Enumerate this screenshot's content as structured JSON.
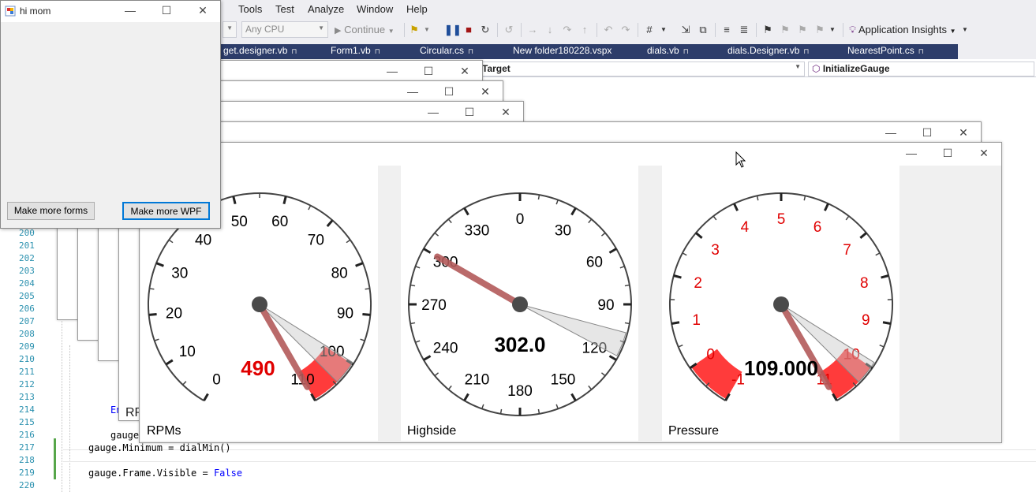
{
  "vs": {
    "menu": [
      "Tools",
      "Test",
      "Analyze",
      "Window",
      "Help"
    ],
    "toolbar": {
      "platform": "Any CPU",
      "continue_label": "Continue",
      "app_insights": "Application Insights"
    },
    "tabs": [
      {
        "label": "get.designer.vb"
      },
      {
        "label": "Form1.vb"
      },
      {
        "label": "Circular.cs"
      },
      {
        "label": "New folder180228.vspx"
      },
      {
        "label": "dials.vb"
      },
      {
        "label": "dials.Designer.vb"
      },
      {
        "label": "NearestPoint.cs"
      }
    ],
    "nav": {
      "left": "Target",
      "right": "InitializeGauge"
    }
  },
  "editor": {
    "line_numbers": [
      "200",
      "201",
      "202",
      "203",
      "204",
      "205",
      "206",
      "207",
      "208",
      "209",
      "210",
      "211",
      "212",
      "213",
      "214",
      "215",
      "216",
      "217",
      "218",
      "219",
      "220"
    ],
    "fragments": {
      "en": "En",
      "rp": "RP",
      "gauge_partial": "gauge"
    },
    "code": {
      "line217_a": "gauge.Minimum = dialMin()",
      "line219_a": "gauge.Frame.Visible = ",
      "line219_kw": "False"
    }
  },
  "himom": {
    "title": "hi mom",
    "btn_forms": "Make more forms",
    "btn_wpf": "Make more WPF"
  },
  "gauges": [
    {
      "caption": "RPMs",
      "readout": "490",
      "readout_color": "#e00000",
      "ticks": [
        "0",
        "10",
        "20",
        "30",
        "40",
        "50",
        "60",
        "70",
        "80",
        "90",
        "100",
        "110"
      ],
      "tick_color": "#000000",
      "min": 0,
      "max": 110,
      "value": 110
    },
    {
      "caption": "Highside",
      "readout": "302.0",
      "readout_color": "#000000",
      "ticks": [
        "0",
        "30",
        "60",
        "90",
        "120",
        "150",
        "180",
        "210",
        "240",
        "270",
        "300",
        "330"
      ],
      "tick_color": "#000000",
      "value": 300
    },
    {
      "caption": "Pressure",
      "readout": "109.000",
      "readout_color": "#000000",
      "ticks": [
        "-1",
        "0",
        "1",
        "2",
        "3",
        "4",
        "5",
        "6",
        "7",
        "8",
        "9",
        "10",
        "11"
      ],
      "tick_color": "#e00000",
      "min": -1,
      "max": 11,
      "value": 11
    }
  ],
  "colors": {
    "accent": "#0078d7",
    "needle": "#b35a5a",
    "redzone": "#ff3b3b"
  }
}
